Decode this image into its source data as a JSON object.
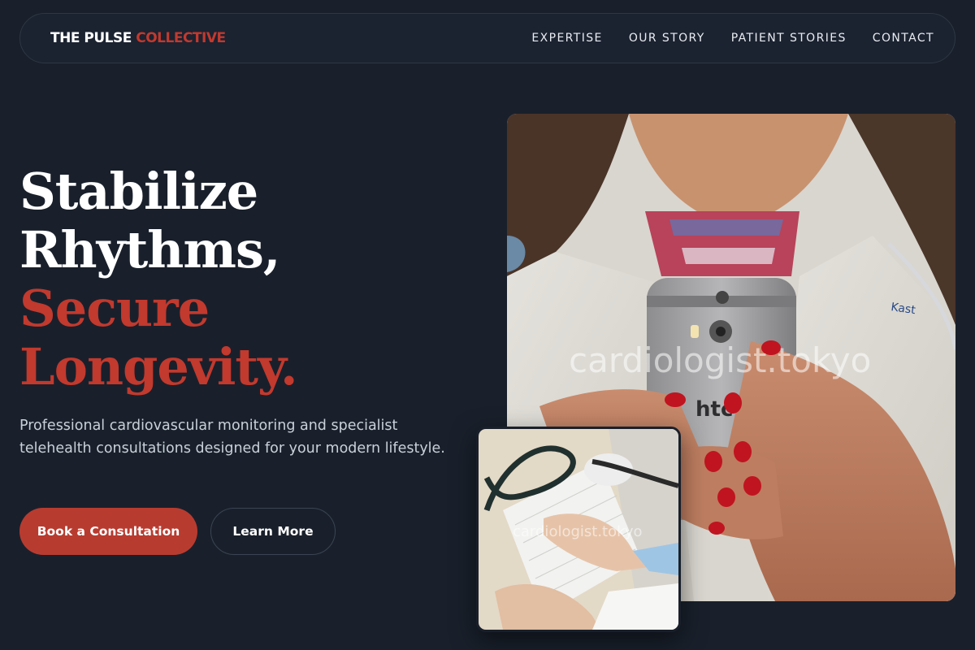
{
  "nav": {
    "brand_part1": "THE PULSE",
    "brand_part2": "COLLECTIVE",
    "links": [
      "EXPERTISE",
      "OUR STORY",
      "PATIENT STORIES",
      "CONTACT"
    ]
  },
  "hero": {
    "headline_lines": [
      "Stabilize",
      "Rhythms,",
      "Secure",
      "Longevity."
    ],
    "subtitle": "Professional cardiovascular monitoring and specialist telehealth consultations designed for your modern lifestyle.",
    "primary_button": "Book a Consultation",
    "secondary_button": "Learn More"
  },
  "images": {
    "main_watermark": "cardiologist.tokyo",
    "small_watermark": "cardiologist.tokyo",
    "phone_brand": "htc"
  },
  "colors": {
    "background": "#19202b",
    "accent": "#c2392e",
    "button": "#b83b30"
  }
}
